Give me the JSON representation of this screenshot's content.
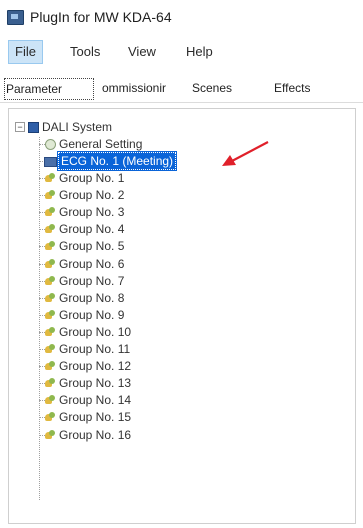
{
  "window": {
    "title": "PlugIn for MW KDA-64"
  },
  "menu": {
    "items": [
      "File",
      "Tools",
      "View",
      "Help"
    ],
    "active_index": 0
  },
  "tabs": {
    "items": [
      "Parameter",
      "ommissionir",
      "Scenes",
      "Effects"
    ],
    "selected_index": 0
  },
  "tree": {
    "root": "DALI System",
    "general_setting": "General Setting",
    "ecg": "ECG No. 1 (Meeting)",
    "groups": [
      "Group No. 1",
      "Group No. 2",
      "Group No. 3",
      "Group No. 4",
      "Group No. 5",
      "Group No. 6",
      "Group No. 7",
      "Group No. 8",
      "Group No. 9",
      "Group No. 10",
      "Group No. 11",
      "Group No. 12",
      "Group No. 13",
      "Group No. 14",
      "Group No. 15",
      "Group No. 16"
    ]
  },
  "colors": {
    "selection": "#0a64d8",
    "annotation_arrow": "#e0202a",
    "menu_active": "#cce4f7"
  }
}
